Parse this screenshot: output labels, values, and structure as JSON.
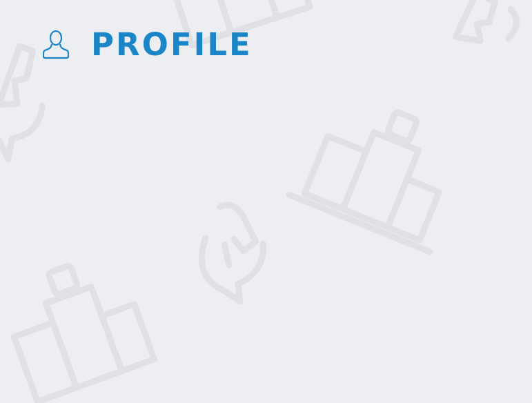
{
  "header": {
    "title": "PROFILE",
    "icon": "user-icon"
  },
  "colors": {
    "background": "#edeef2",
    "accent": "#1a86c8",
    "pattern": "#dadce2"
  }
}
